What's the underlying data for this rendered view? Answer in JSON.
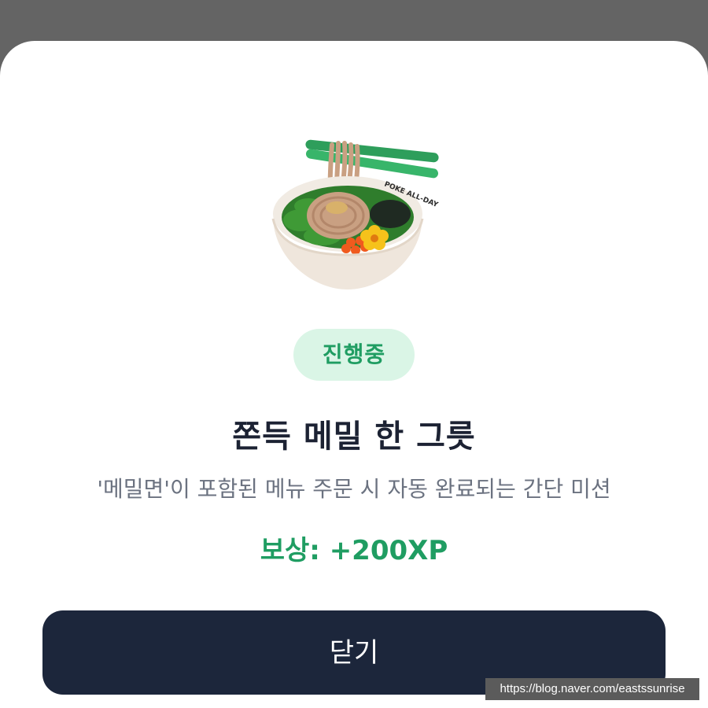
{
  "modal": {
    "image_icon": "soba-noodle-bowl-icon",
    "bowl_text": "POKE ALL-DAY",
    "status_badge": "진행중",
    "title": "쫀득 메밀 한 그릇",
    "description": "'메밀면'이 포함된 메뉴 주문 시 자동 완료되는 간단 미션",
    "reward": "보상: +200XP",
    "close_label": "닫기"
  },
  "watermark": "https://blog.naver.com/eastssunrise",
  "colors": {
    "accent_green": "#1f9d62",
    "badge_bg": "#daf5e6",
    "button_bg": "#1c263b",
    "title_text": "#1c2233",
    "desc_text": "#6b7280"
  }
}
